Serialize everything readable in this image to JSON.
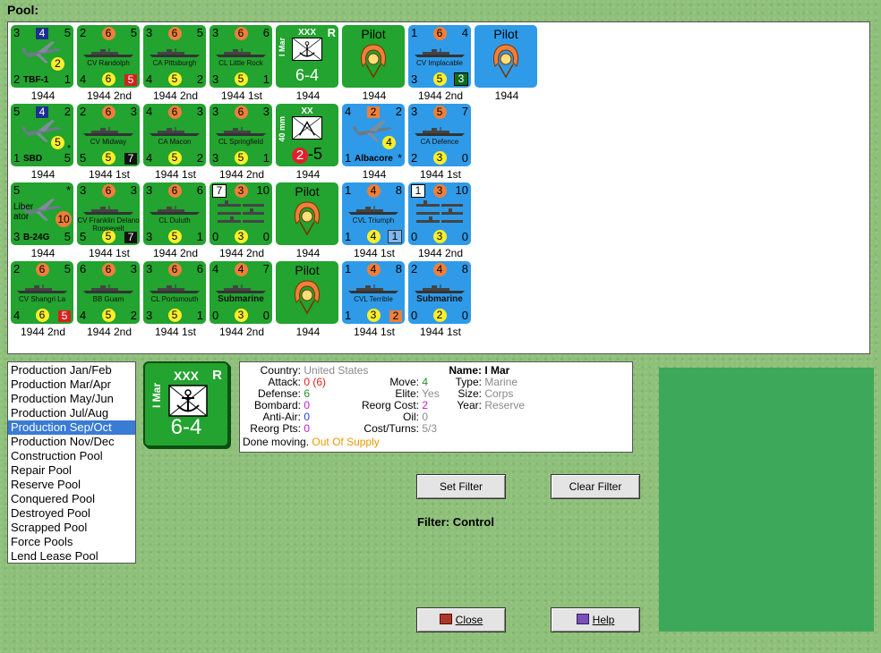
{
  "pool_title": "Pool:",
  "counters": [
    {
      "row": 0,
      "col": 0,
      "color": "green",
      "kind": "air",
      "tl": "3",
      "tc": "4",
      "tc_style": "sq-navy",
      "tr": "5",
      "bl": "2",
      "name": "TBF-1",
      "br": "1",
      "yc": "2",
      "caption": "1944"
    },
    {
      "row": 0,
      "col": 1,
      "color": "green",
      "kind": "ship",
      "tl": "2",
      "tc": "6",
      "tr": "5",
      "name": "CV Randolph",
      "bl": "4",
      "bc": "6",
      "br": "5",
      "br_style": "sq-red",
      "caption": "1944 2nd"
    },
    {
      "row": 0,
      "col": 2,
      "color": "green",
      "kind": "ship",
      "tl": "3",
      "tc": "6",
      "tr": "5",
      "name": "CA Pittsburgh",
      "bl": "4",
      "bc": "5",
      "br": "2",
      "caption": "1944 2nd"
    },
    {
      "row": 0,
      "col": 3,
      "color": "green",
      "kind": "ship",
      "tl": "3",
      "tc": "6",
      "tr": "6",
      "name": "CL Little Rock",
      "bl": "3",
      "bc": "5",
      "br": "1",
      "caption": "1944 1st"
    },
    {
      "row": 0,
      "col": 4,
      "color": "green",
      "kind": "marine",
      "tc": "XXX",
      "tr": "R",
      "side": "I Mar",
      "strength": "6-4",
      "caption": "1944"
    },
    {
      "row": 0,
      "col": 5,
      "color": "green",
      "kind": "pilot",
      "label": "Pilot",
      "caption": "1944"
    },
    {
      "row": 0,
      "col": 6,
      "color": "blue",
      "kind": "ship",
      "tl": "1",
      "tc": "6",
      "tr": "4",
      "name": "CV Implacable",
      "bl": "3",
      "bc": "5",
      "br": "3",
      "br_style": "sq-dgreen",
      "caption": "1944 2nd"
    },
    {
      "row": 0,
      "col": 7,
      "color": "blue",
      "kind": "pilot",
      "label": "Pilot",
      "caption": "1944"
    },
    {
      "row": 1,
      "col": 0,
      "color": "green",
      "kind": "air",
      "tl": "5",
      "tc": "4",
      "tc_style": "sq-navy",
      "tr": "2",
      "bl": "1",
      "name": "SBD",
      "br": "5",
      "yc": "5",
      "star": "*",
      "caption": "1944"
    },
    {
      "row": 1,
      "col": 1,
      "color": "green",
      "kind": "ship",
      "tl": "2",
      "tc": "6",
      "tr": "3",
      "name": "CV Midway",
      "bl": "5",
      "bc": "5",
      "br": "7",
      "br_style": "sq-black",
      "caption": "1944 1st"
    },
    {
      "row": 1,
      "col": 2,
      "color": "green",
      "kind": "ship",
      "tl": "4",
      "tc": "6",
      "tr": "3",
      "name": "CA Macon",
      "bl": "4",
      "bc": "5",
      "br": "2",
      "caption": "1944 1st"
    },
    {
      "row": 1,
      "col": 3,
      "color": "green",
      "kind": "ship",
      "tl": "3",
      "tc": "6",
      "tr": "3",
      "name": "CL Springfield",
      "bl": "3",
      "bc": "5",
      "br": "1",
      "caption": "1944 2nd"
    },
    {
      "row": 1,
      "col": 4,
      "color": "green",
      "kind": "arty",
      "tc": "XX",
      "side": "40 mm",
      "red": "2",
      "strength": "-5",
      "caption": "1944"
    },
    {
      "row": 1,
      "col": 5,
      "color": "blue",
      "kind": "air",
      "tl": "4",
      "tc": "2",
      "tc_style": "sq-orange",
      "tr": "2",
      "bl": "1",
      "name": "Albacore",
      "br": "*",
      "yc": "4",
      "caption": "1944"
    },
    {
      "row": 1,
      "col": 6,
      "color": "blue",
      "kind": "ship",
      "tl": "3",
      "tc": "5",
      "tr": "7",
      "name": "CA Defence",
      "bl": "2",
      "bc": "3",
      "br": "0",
      "caption": "1944 1st"
    },
    {
      "row": 2,
      "col": 0,
      "color": "green",
      "kind": "air",
      "tl": "5",
      "tr": "*",
      "name": "B-24G",
      "side": "Liber ator",
      "bl": "3",
      "br": "5",
      "oc": "10",
      "caption": "1944"
    },
    {
      "row": 2,
      "col": 1,
      "color": "green",
      "kind": "ship",
      "tl": "3",
      "tc": "6",
      "tr": "3",
      "name": "CV Franklin Delano Roosevelt",
      "bl": "5",
      "bc": "5",
      "br": "7",
      "br_style": "sq-black",
      "caption": "1944 1st"
    },
    {
      "row": 2,
      "col": 2,
      "color": "green",
      "kind": "ship",
      "tl": "3",
      "tc": "6",
      "tr": "6",
      "name": "CL Duluth",
      "bl": "3",
      "bc": "5",
      "br": "1",
      "caption": "1944 2nd"
    },
    {
      "row": 2,
      "col": 3,
      "color": "green",
      "kind": "convoy",
      "tl": "7",
      "tl_style": "sq-white",
      "tc": "3",
      "tr": "10",
      "bl": "0",
      "bc": "3",
      "br": "0",
      "caption": "1944 2nd"
    },
    {
      "row": 2,
      "col": 4,
      "color": "green",
      "kind": "pilot",
      "label": "Pilot",
      "caption": "1944"
    },
    {
      "row": 2,
      "col": 5,
      "color": "blue",
      "kind": "ship",
      "tl": "1",
      "tc": "4",
      "tr": "8",
      "name": "CVL Triumph",
      "bl": "1",
      "bc": "4",
      "br": "1",
      "br_style": "sq-lblue",
      "caption": "1944 1st"
    },
    {
      "row": 2,
      "col": 6,
      "color": "blue",
      "kind": "convoy",
      "tl": "1",
      "tl_style": "sq-white",
      "tc": "3",
      "tr": "10",
      "bl": "0",
      "bc": "3",
      "br": "0",
      "caption": "1944 2nd"
    },
    {
      "row": 3,
      "col": 0,
      "color": "green",
      "kind": "ship",
      "tl": "2",
      "tc": "6",
      "tr": "5",
      "name": "CV Shangri La",
      "bl": "4",
      "bc": "6",
      "br": "5",
      "br_style": "sq-red",
      "caption": "1944 2nd"
    },
    {
      "row": 3,
      "col": 1,
      "color": "green",
      "kind": "ship",
      "tl": "6",
      "tc": "6",
      "tr": "3",
      "name": "BB Guam",
      "bl": "4",
      "bc": "5",
      "br": "2",
      "caption": "1944 2nd"
    },
    {
      "row": 3,
      "col": 2,
      "color": "green",
      "kind": "ship",
      "tl": "3",
      "tc": "6",
      "tr": "6",
      "name": "CL Portsmouth",
      "bl": "3",
      "bc": "5",
      "br": "1",
      "caption": "1944 1st"
    },
    {
      "row": 3,
      "col": 3,
      "color": "green",
      "kind": "sub",
      "tl": "4",
      "tc": "4",
      "tr": "7",
      "name": "Submarine",
      "bl": "0",
      "bc": "3",
      "br": "0",
      "caption": "1944 2nd"
    },
    {
      "row": 3,
      "col": 4,
      "color": "green",
      "kind": "pilot",
      "label": "Pilot",
      "caption": "1944"
    },
    {
      "row": 3,
      "col": 5,
      "color": "blue",
      "kind": "ship",
      "tl": "1",
      "tc": "4",
      "tr": "8",
      "name": "CVL Terrible",
      "bl": "1",
      "bc": "3",
      "br": "2",
      "br_style": "sq-orange",
      "caption": "1944 1st"
    },
    {
      "row": 3,
      "col": 6,
      "color": "blue",
      "kind": "sub",
      "tl": "2",
      "tc": "4",
      "tr": "8",
      "name": "Submarine",
      "bl": "0",
      "bc": "2",
      "br": "0",
      "caption": "1944 1st"
    }
  ],
  "pool_list": {
    "selected_index": 4,
    "items": [
      "Production Jan/Feb",
      "Production Mar/Apr",
      "Production May/Jun",
      "Production Jul/Aug",
      "Production Sep/Oct",
      "Production Nov/Dec",
      "Construction Pool",
      "Repair Pool",
      "Reserve Pool",
      "Conquered Pool",
      "Destroyed Pool",
      "Scrapped Pool",
      "Force Pools",
      "Lend Lease Pool"
    ]
  },
  "selected_counter": {
    "size": "XXX",
    "reserve": "R",
    "side": "I Mar",
    "strength": "6-4"
  },
  "info": {
    "country_label": "Country:",
    "country": "United States",
    "attack_label": "Attack:",
    "attack": "0 (6)",
    "defense_label": "Defense:",
    "defense": "6",
    "bombard_label": "Bombard:",
    "bombard": "0",
    "antiair_label": "Anti-Air:",
    "antiair": "0",
    "reorgpts_label": "Reorg Pts:",
    "reorgpts": "0",
    "done_label": "Done moving.",
    "supply": "Out Of Supply",
    "move_label": "Move:",
    "move": "4",
    "elite_label": "Elite:",
    "elite": "Yes",
    "reorgcost_label": "Reorg Cost:",
    "reorgcost": "2",
    "oil_label": "Oil:",
    "oil": "0",
    "costturns_label": "Cost/Turns:",
    "costturns": "5/3",
    "name_label": "Name:",
    "name": "I Mar",
    "type_label": "Type:",
    "type": "Marine",
    "size_label": "Size:",
    "size": "Corps",
    "year_label": "Year:",
    "year": "Reserve"
  },
  "buttons": {
    "set_filter": "Set Filter",
    "clear_filter": "Clear Filter",
    "close": "Close",
    "help": "Help"
  },
  "filter_text": "Filter: Control"
}
